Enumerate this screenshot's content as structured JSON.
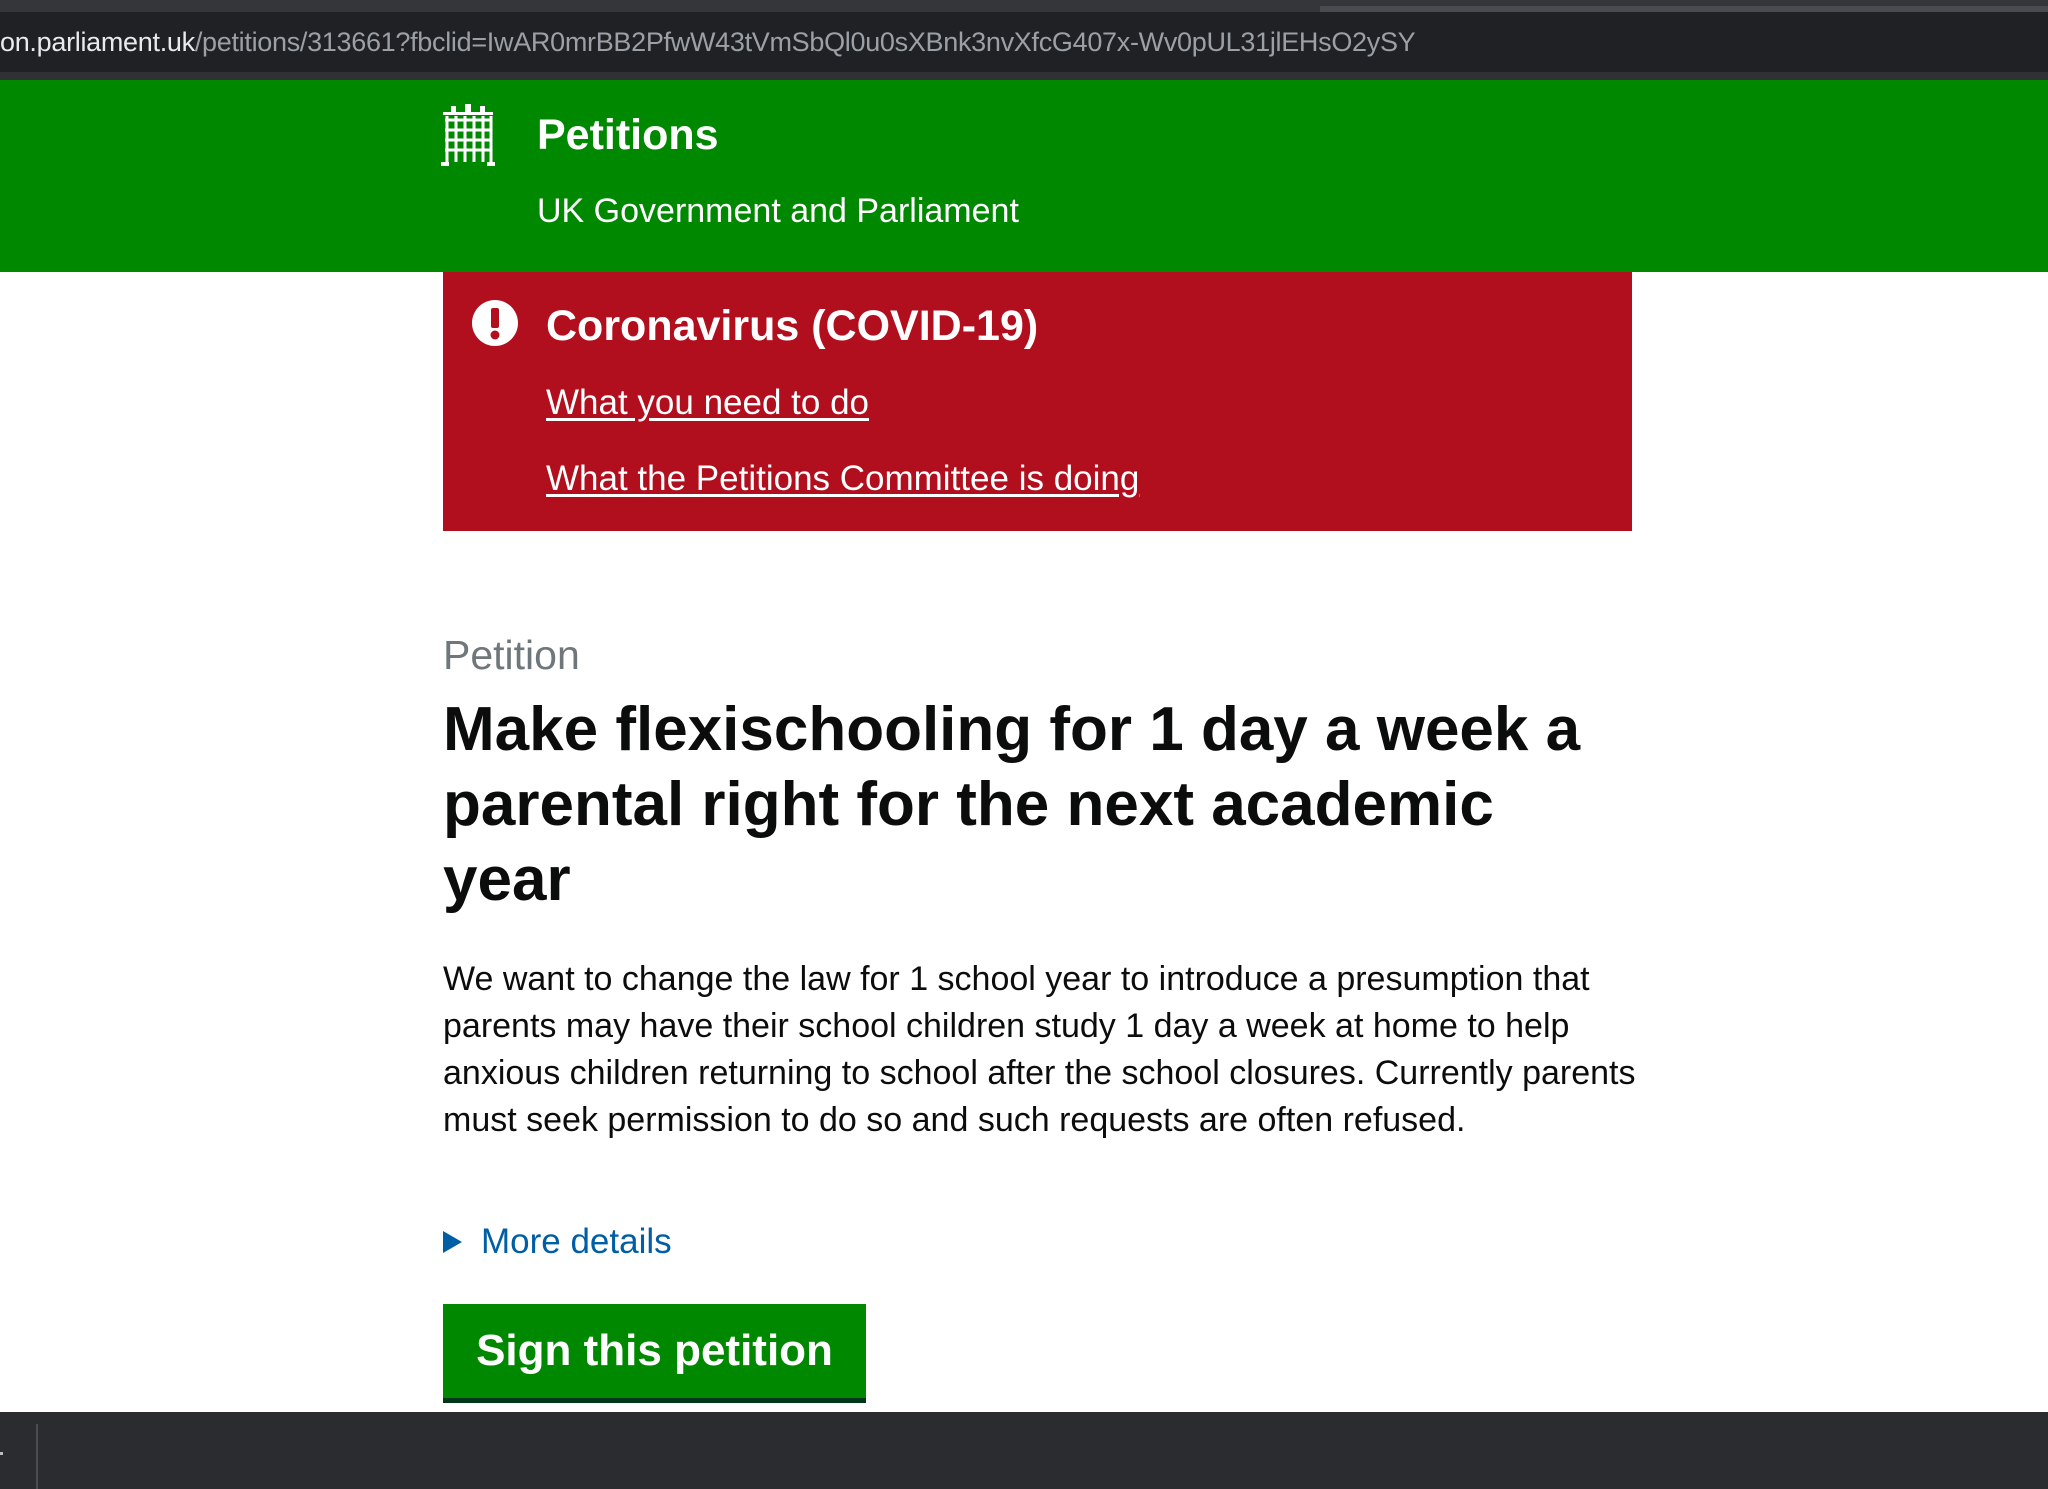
{
  "browser": {
    "url_domain": "on.parliament.uk",
    "url_path": "/petitions/313661?fbclid=IwAR0mrBB2PfwW43tVmSbQl0u0sXBnk3nvXfcG407x-Wv0pUL31jlEHsO2ySY"
  },
  "header": {
    "title": "Petitions",
    "subtitle": "UK Government and Parliament",
    "logo_icon": "portcullis-icon",
    "background": "#008800"
  },
  "alert": {
    "icon": "exclamation-icon",
    "title": "Coronavirus (COVID-19)",
    "links": [
      "What you need to do",
      "What the Petitions Committee is doing"
    ],
    "background": "#b10e1e"
  },
  "petition": {
    "label": "Petition",
    "title": "Make flexischooling for 1 day a week a parental right for the next academic year",
    "body": "We want to change the law for 1 school year to introduce a presumption that parents may have their school children study 1 day a week at home to help anxious children returning to school after the school closures. Currently parents must seek permission to do so and such requests are often refused.",
    "more_details": "More details",
    "sign_button": "Sign this petition"
  }
}
